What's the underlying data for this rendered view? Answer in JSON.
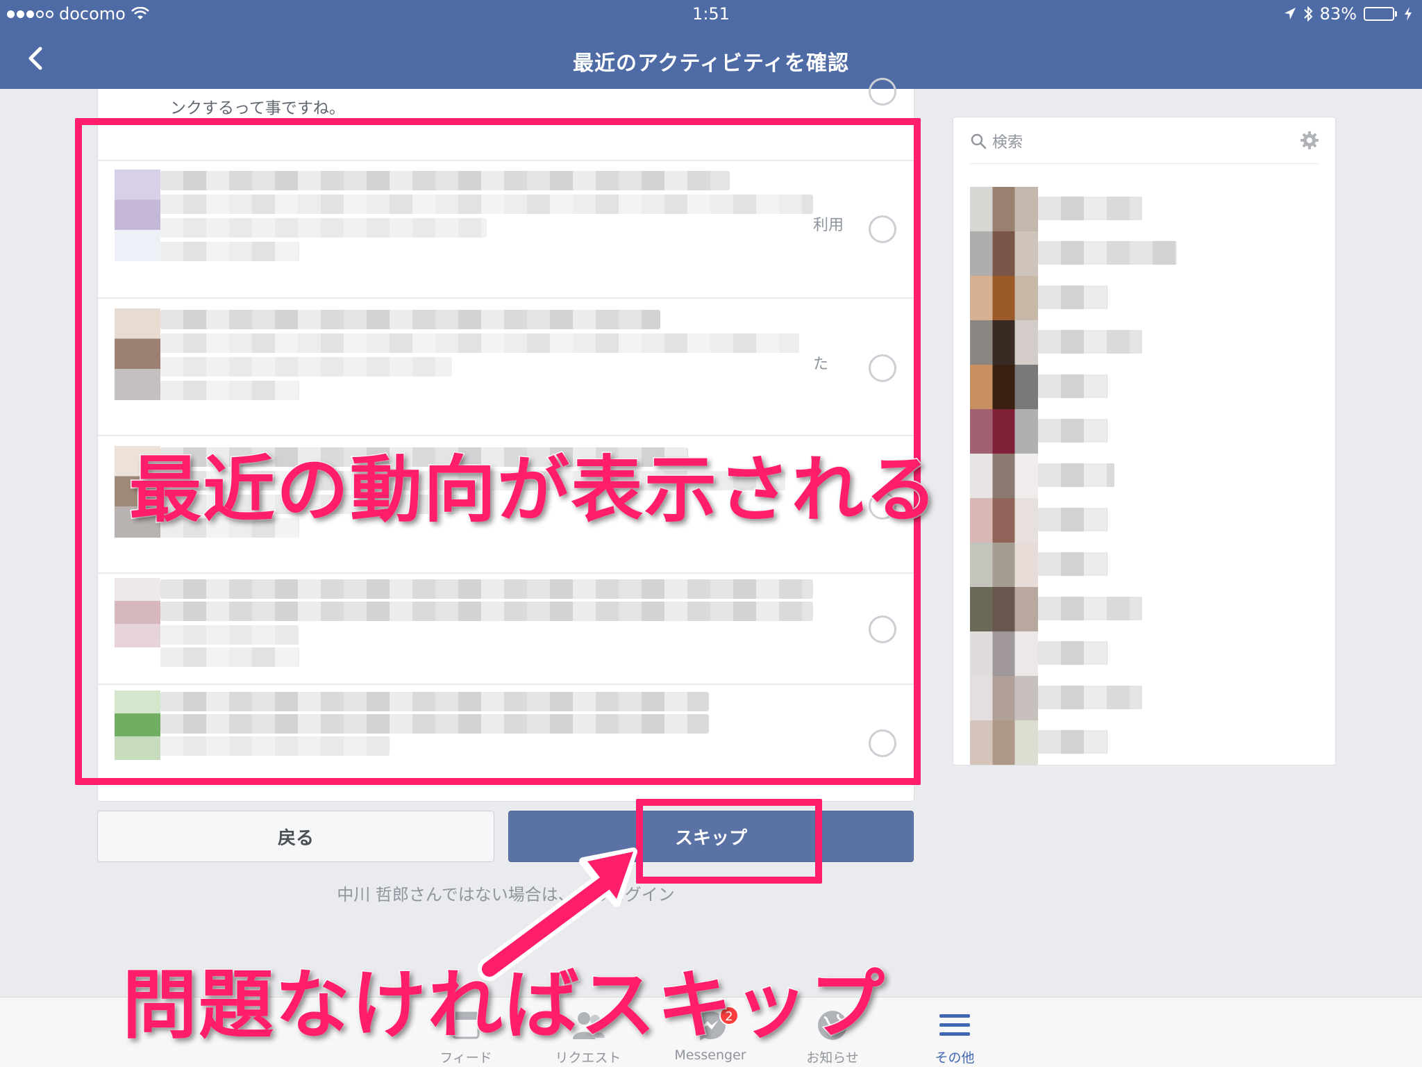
{
  "status_bar": {
    "carrier": "docomo",
    "time": "1:51",
    "battery_percent": "83%",
    "battery_level": 0.83,
    "icons": [
      "signal-dots",
      "wifi-icon",
      "location-arrow-icon",
      "bluetooth-icon",
      "battery-icon",
      "charging-bolt-icon"
    ]
  },
  "nav": {
    "back_icon": "chevron-left-icon",
    "title": "最近のアクティビティを確認"
  },
  "main": {
    "previous_item_text": "ンクするって事ですね。",
    "rows": [
      {
        "suffix": "利用",
        "selected": false
      },
      {
        "suffix": "た",
        "selected": false
      },
      {
        "suffix": "",
        "selected": false
      },
      {
        "suffix": "",
        "selected": false
      },
      {
        "suffix": "",
        "selected": false
      }
    ]
  },
  "buttons": {
    "back_label": "戻る",
    "skip_label": "スキップ"
  },
  "notice": {
    "text": "中川 哲郎さんではない場合は、",
    "link": "からログイン"
  },
  "friends_panel": {
    "search_placeholder": "検索",
    "search_icon": "search-icon",
    "settings_icon": "gear-icon",
    "friend_count": 13
  },
  "annotations": {
    "main_caption": "最近の動向が表示される",
    "skip_caption": "問題なければスキップ",
    "color": "#ff1d6c"
  },
  "tab_bar": {
    "tabs": [
      {
        "label": "フィード",
        "icon": "feed-icon",
        "active": false
      },
      {
        "label": "リクエスト",
        "icon": "friend-requests-icon",
        "active": false
      },
      {
        "label": "Messenger",
        "icon": "messenger-icon",
        "active": false,
        "badge": "2"
      },
      {
        "label": "お知らせ",
        "icon": "globe-notifications-icon",
        "active": false
      },
      {
        "label": "その他",
        "icon": "menu-icon",
        "active": true
      }
    ]
  },
  "colors": {
    "brand": "#4e6ba6",
    "skip_button": "#5b72a4",
    "highlight": "#ff1d6c"
  }
}
